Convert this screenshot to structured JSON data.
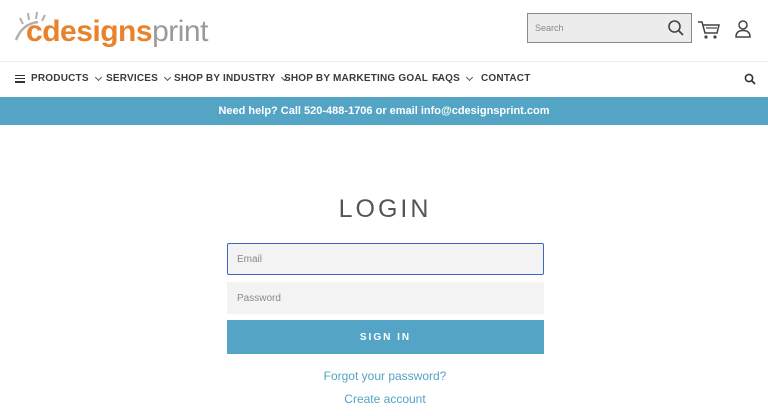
{
  "logo": {
    "c": "c",
    "designs": "designs",
    "print": "print"
  },
  "header": {
    "search_placeholder": "Search"
  },
  "nav": {
    "items": [
      {
        "label": "PRODUCTS"
      },
      {
        "label": "SERVICES"
      },
      {
        "label": "SHOP BY INDUSTRY"
      },
      {
        "label": "SHOP BY MARKETING GOAL"
      },
      {
        "label": "FAQS"
      },
      {
        "label": "CONTACT"
      }
    ]
  },
  "banner": {
    "text": "Need help? Call 520-488-1706 or email info@cdesignsprint.com"
  },
  "login": {
    "title": "LOGIN",
    "email_placeholder": "Email",
    "password_placeholder": "Password",
    "signin_label": "SIGN IN",
    "forgot_label": "Forgot your password?",
    "create_label": "Create account"
  },
  "colors": {
    "accent": "#53a4c5",
    "brand_orange": "#e8822b",
    "focus": "#3b65c8"
  },
  "icons": [
    "search-icon",
    "cart-icon",
    "user-icon",
    "menu-icon",
    "chevron-down-icon"
  ]
}
